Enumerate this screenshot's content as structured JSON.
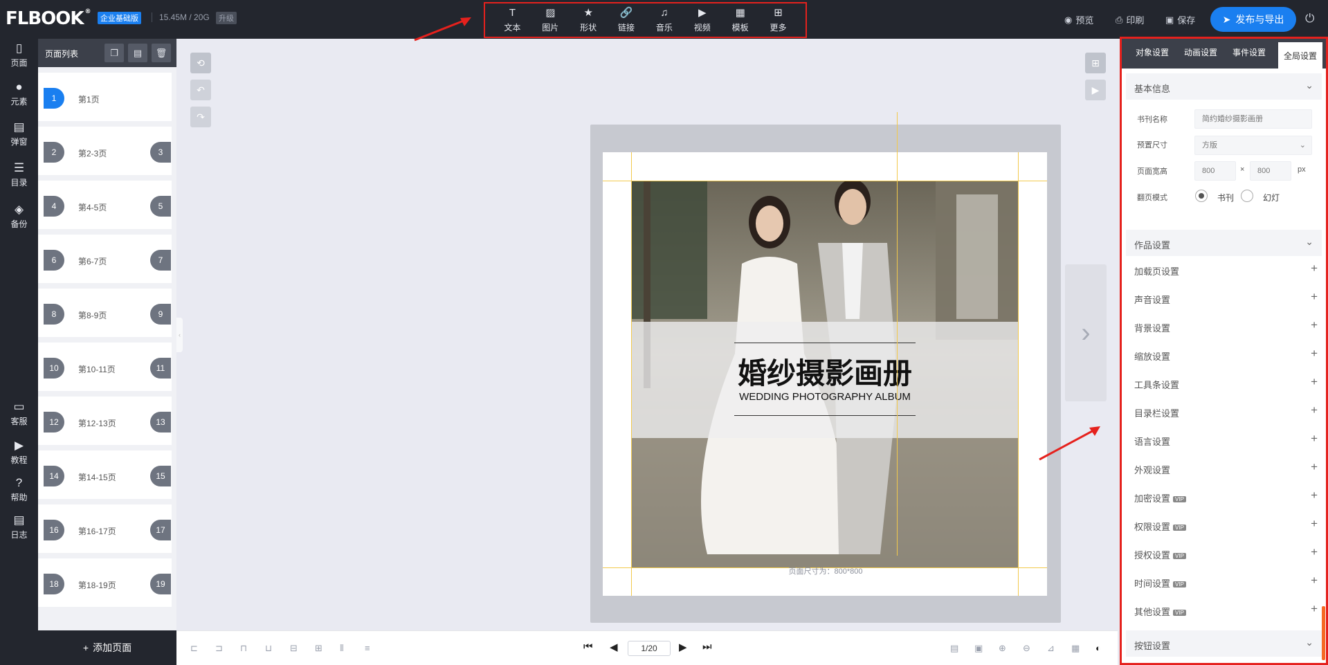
{
  "app": {
    "logo": "FLBOOK",
    "logo_mark": "®",
    "edition": "企业基础版",
    "storage": "15.45M / 20G",
    "upgrade": "升级"
  },
  "toolbar": [
    {
      "label": "文本",
      "icon": "text-icon",
      "glyph": "T"
    },
    {
      "label": "图片",
      "icon": "image-icon",
      "glyph": "▨"
    },
    {
      "label": "形状",
      "icon": "star-icon",
      "glyph": "★"
    },
    {
      "label": "链接",
      "icon": "link-icon",
      "glyph": "🔗"
    },
    {
      "label": "音乐",
      "icon": "music-icon",
      "glyph": "♫"
    },
    {
      "label": "视频",
      "icon": "video-icon",
      "glyph": "▶"
    },
    {
      "label": "模板",
      "icon": "template-icon",
      "glyph": "▦"
    },
    {
      "label": "更多",
      "icon": "more-icon",
      "glyph": "⊞"
    }
  ],
  "top_actions": {
    "preview": "预览",
    "print": "印刷",
    "save": "保存",
    "publish": "发布与导出"
  },
  "rail": [
    {
      "label": "页面",
      "glyph": "▯"
    },
    {
      "label": "元素",
      "glyph": "●"
    },
    {
      "label": "弹窗",
      "glyph": "▤"
    },
    {
      "label": "目录",
      "glyph": "☰"
    },
    {
      "label": "备份",
      "glyph": "◈"
    },
    {
      "label": "客服",
      "glyph": "▭"
    },
    {
      "label": "教程",
      "glyph": "▶"
    },
    {
      "label": "帮助",
      "glyph": "?"
    },
    {
      "label": "日志",
      "glyph": "▤"
    }
  ],
  "page_list": {
    "title": "页面列表",
    "add_page": "添加页面",
    "pages": [
      {
        "left": "1",
        "name": "第1页",
        "right": ""
      },
      {
        "left": "2",
        "name": "第2-3页",
        "right": "3"
      },
      {
        "left": "4",
        "name": "第4-5页",
        "right": "5"
      },
      {
        "left": "6",
        "name": "第6-7页",
        "right": "7"
      },
      {
        "left": "8",
        "name": "第8-9页",
        "right": "9"
      },
      {
        "left": "10",
        "name": "第10-11页",
        "right": "11"
      },
      {
        "left": "12",
        "name": "第12-13页",
        "right": "13"
      },
      {
        "left": "14",
        "name": "第14-15页",
        "right": "15"
      },
      {
        "left": "16",
        "name": "第16-17页",
        "right": "17"
      },
      {
        "left": "18",
        "name": "第18-19页",
        "right": "19"
      }
    ]
  },
  "canvas": {
    "title_zh": "婚纱摄影画册",
    "title_en": "WEDDING PHOTOGRAPHY ALBUM",
    "page_size_note": "页面尺寸为：800*800"
  },
  "pager": {
    "indicator": "1/20"
  },
  "right_panel": {
    "tabs": [
      "对象设置",
      "动画设置",
      "事件设置",
      "全局设置"
    ],
    "active_tab": "全局设置",
    "basic_info": "基本信息",
    "book_name_label": "书刊名称",
    "book_name_value": "简约婚纱摄影画册",
    "preset_size_label": "预置尺寸",
    "preset_size_value": "方版",
    "page_wh_label": "页面宽高",
    "width": "800",
    "height": "800",
    "times": "×",
    "unit": "px",
    "flip_mode_label": "翻页模式",
    "flip_mode_book": "书刊",
    "flip_mode_slide": "幻灯",
    "work_settings": "作品设置",
    "settings": [
      {
        "label": "加载页设置",
        "vip": ""
      },
      {
        "label": "声音设置",
        "vip": ""
      },
      {
        "label": "背景设置",
        "vip": ""
      },
      {
        "label": "缩放设置",
        "vip": ""
      },
      {
        "label": "工具条设置",
        "vip": ""
      },
      {
        "label": "目录栏设置",
        "vip": ""
      },
      {
        "label": "语言设置",
        "vip": ""
      },
      {
        "label": "外观设置",
        "vip": ""
      },
      {
        "label": "加密设置",
        "vip": "VIP"
      },
      {
        "label": "权限设置",
        "vip": "VIP"
      },
      {
        "label": "授权设置",
        "vip": "VIP"
      },
      {
        "label": "时间设置",
        "vip": "VIP"
      },
      {
        "label": "其他设置",
        "vip": "VIP"
      }
    ],
    "button_settings": "按钮设置"
  },
  "colors": {
    "accent": "#1a7ff0",
    "annotation": "#e5211d",
    "dark_bar": "#23262e"
  }
}
